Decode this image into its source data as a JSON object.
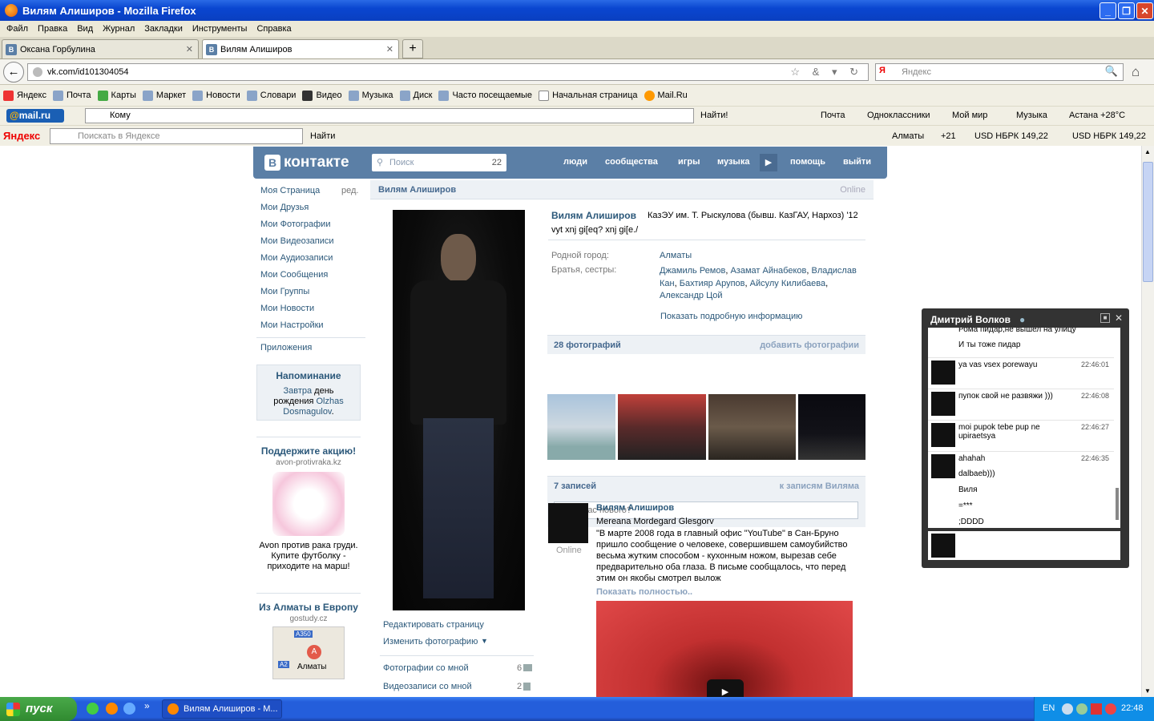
{
  "window": {
    "title": "Вилям Алиширов - Mozilla Firefox",
    "minimize": "_",
    "maximize": "❐",
    "close": "✕"
  },
  "menu": [
    "Файл",
    "Правка",
    "Вид",
    "Журнал",
    "Закладки",
    "Инструменты",
    "Справка"
  ],
  "tabs": [
    {
      "favicon": "В",
      "label": "Оксана Горбулина"
    },
    {
      "favicon": "В",
      "label": "Вилям Алиширов"
    }
  ],
  "tab_close": "✕",
  "new_tab": "+",
  "nav": {
    "back": "←",
    "url": "vk.com/id101304054",
    "url_icons": "☆ & ▾ ↻",
    "search_placeholder": "Яндекс",
    "search_engine": "Я",
    "home": "⌂"
  },
  "bookmarks": [
    "Яндекс",
    "Почта",
    "Карты",
    "Маркет",
    "Новости",
    "Словари",
    "Видео",
    "Музыка",
    "Диск",
    "Часто посещаемые",
    "Начальная страница",
    "Mail.Ru"
  ],
  "mailru_bar": {
    "logo_at": "@",
    "logo": "mail.ru",
    "to_placeholder": "Кому",
    "find": "Найти!",
    "mail": "Почта",
    "ok": "Одноклассники",
    "myworld": "Мой мир",
    "music": "Музыка",
    "weather": "Астана +28°C"
  },
  "yandex_bar": {
    "logo": "Яндекс",
    "search_placeholder": "Поискать в Яндексе",
    "find": "Найти",
    "city": "Алматы",
    "temp": "+21",
    "rate1": "USD НБРК 149,22",
    "rate2": "USD НБРК 149,22"
  },
  "vk": {
    "logo_letter": "В",
    "logo": "контакте",
    "search_placeholder": "Поиск",
    "search_count": "22",
    "nav": [
      "люди",
      "сообщества",
      "игры",
      "музыка",
      "помощь",
      "выйти"
    ],
    "left_menu": [
      "Моя Страница",
      "Мои Друзья",
      "Мои Фотографии",
      "Мои Видеозаписи",
      "Мои Аудиозаписи",
      "Мои Сообщения",
      "Мои Группы",
      "Мои Новости",
      "Мои Настройки"
    ],
    "edit": "ред.",
    "apps": "Приложения",
    "reminder": {
      "title": "Напоминание",
      "t1": "Завтра",
      "t2": "день",
      "t3": "рождения",
      "t4": "Olzhas",
      "t5": "Dosmagulov",
      "dot": "."
    },
    "ad1": {
      "title": "Поддержите акцию!",
      "domain": "avon-protivraka.kz",
      "text": "Avon против рака груди. Купите футболку - приходите на марш!"
    },
    "ad2": {
      "title": "Из Алматы в Европу",
      "domain": "gostudy.cz",
      "map_label": "Алматы",
      "road1": "A350",
      "road2": "A2",
      "pin": "A"
    },
    "profile": {
      "name": "Вилям Алиширов",
      "status_online": "Online",
      "education": "КазЭУ им. Т. Рыскулова (бывш. КазГАУ, Нархоз) '12",
      "status": "vyt xnj gi[eq? xnj gi[e./",
      "hometown_label": "Родной город:",
      "hometown": "Алматы",
      "siblings_label": "Братья, сестры:",
      "siblings": [
        "Джамиль Ремов",
        "Азамат Айнабеков",
        "Владислав Кан",
        "Бахтияр Арупов",
        "Айсулу Килибаева",
        "Александр Цой"
      ],
      "more_info": "Показать подробную информацию",
      "edit_page": "Редактировать страницу",
      "change_photo": "Изменить фотографию",
      "photos_with_me": "Фотографии со мной",
      "photos_with_me_count": "6",
      "videos_with_me": "Видеозаписи со мной",
      "videos_with_me_count": "2",
      "photos_header": "28 фотографий",
      "add_photos": "добавить фотографии",
      "wall_header": "7 записей",
      "wall_link": "к записям Виляма",
      "wall_placeholder": "Что у Вас нового?",
      "post": {
        "author": "Вилям Алиширов",
        "online": "Online",
        "line1": "Mereana Mordegard Glesgorv",
        "text": "\"В марте 2008 года в главный офис \"YouTube\" в Сан-Бруно пришло сообщение о человеке, совершившем самоубийство весьма жутким способом - кухонным ножом, вырезав себе предварительно оба глаза. В письме сообщалось, что перед этим он якобы смотрел вылож",
        "more": "Показать полностью.."
      }
    }
  },
  "chat": {
    "title": "Дмитрий Волков",
    "messages": [
      {
        "text": "Рома пидар,не вышел на улицу",
        "time": ""
      },
      {
        "text": "И ты тоже пидар",
        "time": ""
      },
      {
        "text": "ya vas vsex porewayu",
        "time": "22:46:01"
      },
      {
        "text": "пупок свой не развяжи )))",
        "time": "22:46:08"
      },
      {
        "text": "moi pupok tebe pup ne upiraetsya",
        "time": "22:46:27"
      },
      {
        "text": "ahahah",
        "time": "22:46:35"
      },
      {
        "text": "dalbaeb)))",
        "time": ""
      },
      {
        "text": "Виля",
        "time": ""
      },
      {
        "text": "=***",
        "time": ""
      },
      {
        "text": ";DDDD",
        "time": ""
      }
    ]
  },
  "taskbar": {
    "start": "пуск",
    "item": "Вилям Алиширов - M...",
    "lang": "EN",
    "time": "22:48",
    "more": "»"
  }
}
